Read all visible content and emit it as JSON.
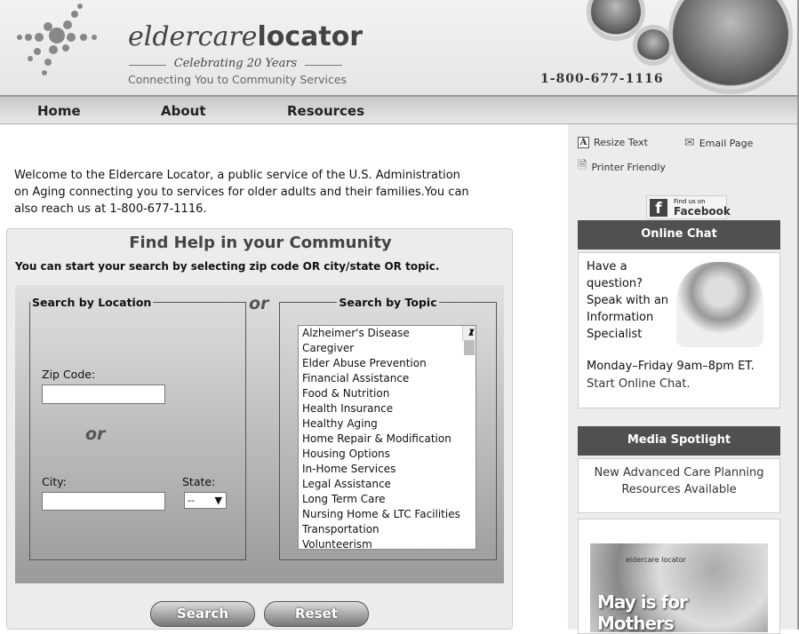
{
  "header": {
    "logo_light": "eldercare",
    "logo_bold": "locator",
    "celebrating": "Celebrating 20 Years",
    "tagline": "Connecting You to Community Services",
    "phone": "1-800-677-1116"
  },
  "nav": [
    {
      "label": "Home"
    },
    {
      "label": "About"
    },
    {
      "label": "Resources"
    }
  ],
  "welcome": "Welcome to the Eldercare Locator, a public service of the U.S. Administration on Aging connecting you to services for older adults and their families.You can also reach us at 1-800-677-1116.",
  "find": {
    "title": "Find Help in your Community",
    "subtitle": "You can start your search by selecting zip code OR city/state OR topic.",
    "or": "or",
    "location": {
      "legend": "Search by Location",
      "zip_label": "Zip Code:",
      "zip_value": "",
      "city_label": "City:",
      "city_value": "",
      "state_label": "State:",
      "state_value": "--"
    },
    "topic": {
      "legend": "Search by Topic",
      "items": [
        "Alzheimer's Disease",
        "Caregiver",
        "Elder Abuse Prevention",
        "Financial Assistance",
        "Food & Nutrition",
        "Health Insurance",
        "Healthy Aging",
        "Home Repair & Modification",
        "Housing Options",
        "In-Home Services",
        "Legal Assistance",
        "Long Term Care",
        "Nursing Home & LTC Facilities",
        "Transportation",
        "Volunteerism"
      ]
    },
    "search_label": "Search",
    "reset_label": "Reset"
  },
  "sidebar": {
    "resize": "Resize Text",
    "email": "Email Page",
    "print": "Printer Friendly",
    "fb_small": "Find us on",
    "fb_big": "Facebook",
    "chat_title": "Online Chat",
    "chat_text": "Have a question? Speak with an Information Specialist",
    "chat_hours": "Monday–Friday 9am–8pm ET.",
    "chat_link": "Start Online Chat.",
    "media_title": "Media Spotlight",
    "media_text": "New Advanced Care Planning Resources Available",
    "promo_text": "May is for Mothers",
    "promo_logo": "eldercare locator"
  }
}
